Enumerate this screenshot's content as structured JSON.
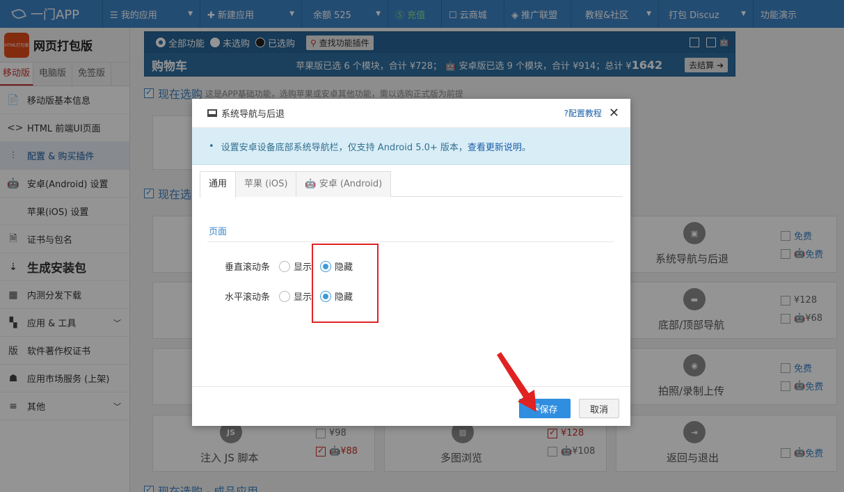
{
  "topnav": {
    "logo": "一门APP",
    "items": [
      {
        "label": "☰ 我的应用",
        "caret": "▼"
      },
      {
        "label": "✚ 新建应用",
        "caret": "▼"
      },
      {
        "label": "余额 525",
        "caret": "▼"
      },
      {
        "label": "Ⓢ 充值",
        "caret": ""
      },
      {
        "label": "☐ 云商城",
        "caret": ""
      },
      {
        "label": "◈ 推广联盟",
        "caret": ""
      },
      {
        "label": "教程&社区",
        "caret": "▼"
      },
      {
        "label": "打包 Discuz",
        "caret": "▼"
      },
      {
        "label": "功能演示",
        "caret": ""
      }
    ]
  },
  "sidebar": {
    "app_icon_text": "HTML打包版",
    "app_name": "网页打包版",
    "version_tabs": [
      "移动版",
      "电脑版",
      "免签版"
    ],
    "items": [
      {
        "label": "移动版基本信息",
        "icon": "📄"
      },
      {
        "label": "HTML 前端UI页面",
        "icon": "<>"
      },
      {
        "label": "配置 & 购买插件",
        "icon": "⫶"
      },
      {
        "label": "安卓(Android) 设置",
        "icon": "🤖"
      },
      {
        "label": "苹果(iOS) 设置",
        "icon": ""
      },
      {
        "label": "证书与包名",
        "icon": "🗎"
      },
      {
        "label": "生成安装包",
        "icon": "⇣"
      },
      {
        "label": "内测分发下载",
        "icon": "▦"
      },
      {
        "label": "应用 & 工具",
        "icon": "▚"
      },
      {
        "label": "软件著作权证书",
        "icon": "版"
      },
      {
        "label": "应用市场服务 (上架)",
        "icon": "☗"
      },
      {
        "label": "其他",
        "icon": "≡"
      }
    ]
  },
  "cart": {
    "filter_all": "全部功能",
    "filter_unselected": "未选购",
    "filter_selected": "已选购",
    "find_btn": "查找功能插件",
    "title": "购物车",
    "summary_prefix": "苹果版已选 6 个模块，合计 ¥728；",
    "summary_mid": "安卓版已选 9 个模块，合计 ¥914；总计 ¥",
    "total": "1642",
    "checkout": "去结算 ➔"
  },
  "sections": {
    "s1_title": "现在选购",
    "s1_note": "这是APP基础功能，选购苹果或安卓其他功能，需以选购正式版为前提",
    "s2_title": "现在选",
    "s3_title": "现在选购 - 成品应用"
  },
  "cards": [
    {
      "title": "系统导航与后退",
      "p1": "免费",
      "p2": "免费"
    },
    {
      "title": "底部/顶部导航",
      "p1": "¥128",
      "p2": "¥68"
    },
    {
      "title": "拍照/录制上传",
      "p1": "免费",
      "p2": "免费"
    },
    {
      "title": "注入 JS 脚本",
      "p1": "¥98",
      "p2": "¥88"
    },
    {
      "title": "多图浏览",
      "p1": "¥128",
      "p2": "¥108"
    },
    {
      "title": "返回与退出",
      "p1": "免费",
      "p2": ""
    }
  ],
  "modal": {
    "title": "系统导航与后退",
    "help": "?配置教程",
    "close": "✕",
    "info_text": "设置安卓设备底部系统导航栏，仅支持 Android 5.0+ 版本，",
    "info_link": "查看更新说明",
    "info_end": "。",
    "tabs": [
      "通用",
      " 苹果 (iOS)",
      " 安卓 (Android)"
    ],
    "group": "页面",
    "rows": [
      {
        "label": "垂直滚动条",
        "opt_show": "显示",
        "opt_hide": "隐藏",
        "selected": "隐藏"
      },
      {
        "label": "水平滚动条",
        "opt_show": "显示",
        "opt_hide": "隐藏",
        "selected": "隐藏"
      }
    ],
    "save": "保存",
    "cancel": "取消"
  },
  "colors": {
    "accent": "#3d84c6",
    "highlight": "#e02222"
  }
}
